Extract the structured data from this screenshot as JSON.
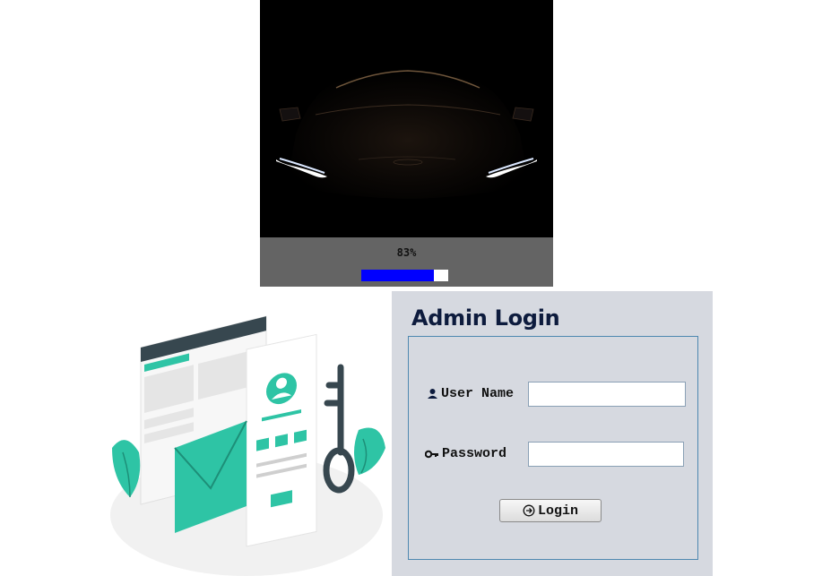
{
  "splash": {
    "image_subject": "car-headlights",
    "progress_text": "83%",
    "progress_value": 0.83,
    "colors": {
      "background": "#000000",
      "bar_background": "#646464",
      "progress_fill": "#0000ff",
      "progress_track": "#ffffff"
    }
  },
  "illustration": {
    "subject": "login-security-illustration",
    "accent_color": "#2ec4a5"
  },
  "login": {
    "title": "Admin Login",
    "username_label": "User Name",
    "username_value": "",
    "password_label": "Password",
    "password_value": "",
    "button_label": "Login",
    "icons": {
      "username": "user-icon",
      "password": "key-icon",
      "button": "login-arrow-icon"
    },
    "colors": {
      "panel_background": "#d6d9e0",
      "title": "#0d1b3d",
      "box_border": "#4e88b0"
    }
  }
}
